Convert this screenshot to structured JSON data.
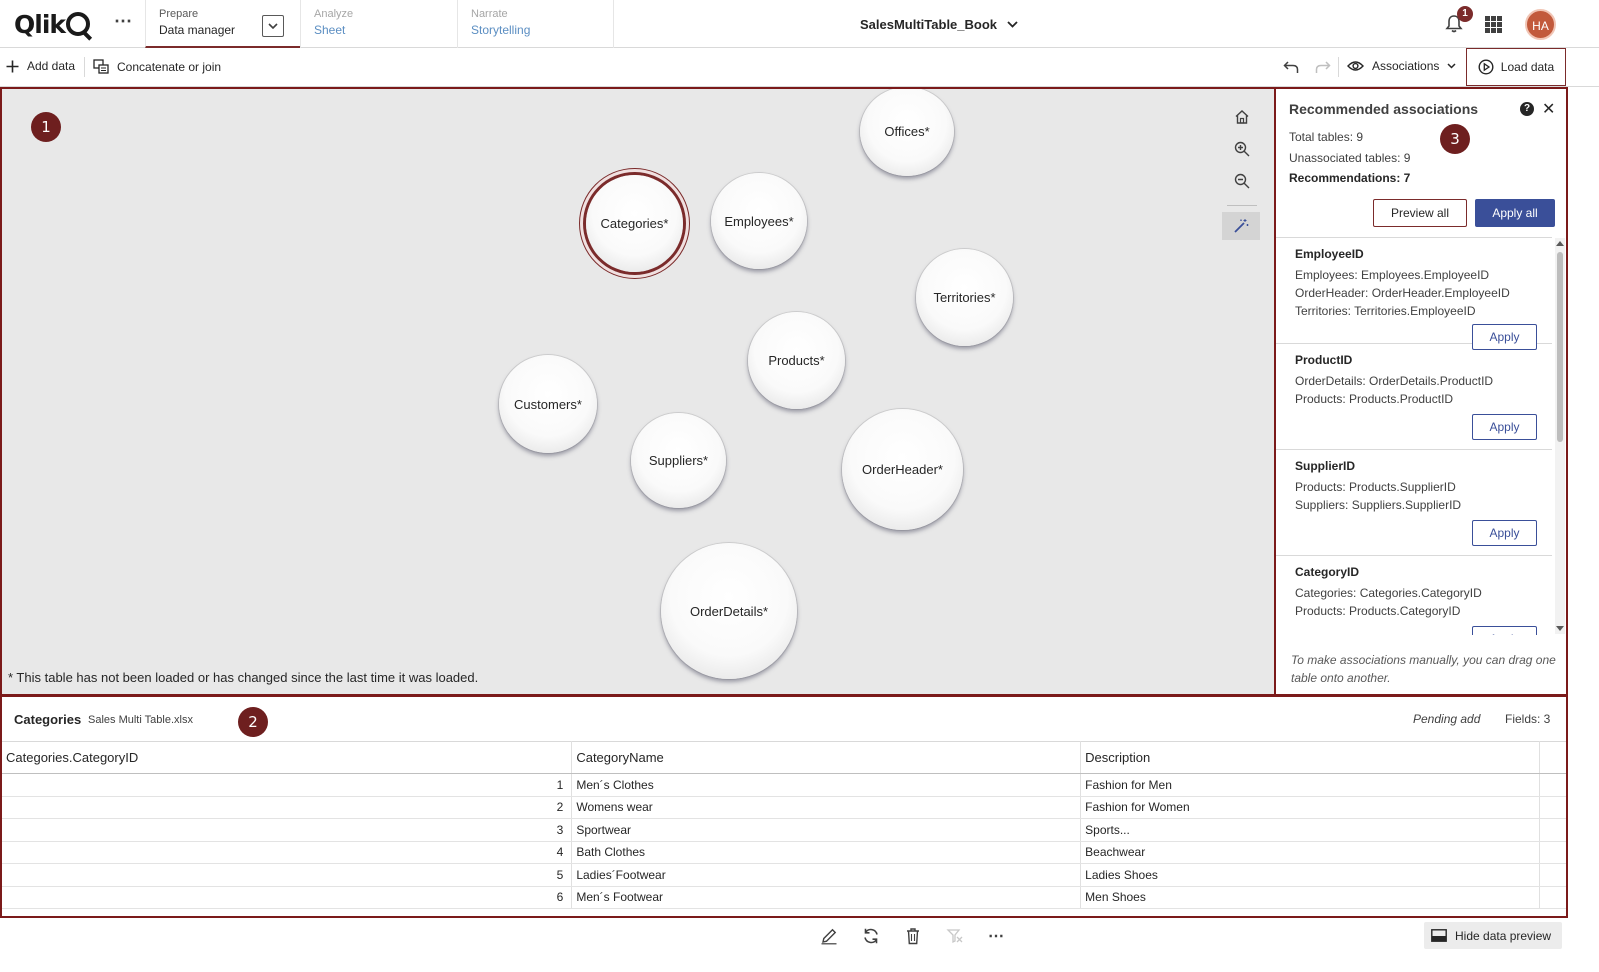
{
  "header": {
    "logo_text": "Qlik",
    "tabs": [
      {
        "small": "Prepare",
        "big": "Data manager"
      },
      {
        "small": "Analyze",
        "big": "Sheet"
      },
      {
        "small": "Narrate",
        "big": "Storytelling"
      }
    ],
    "app_title": "SalesMultiTable_Book",
    "notification_count": "1",
    "avatar_initials": "HA"
  },
  "toolbar": {
    "add_data": "Add data",
    "concat_join": "Concatenate or join",
    "associations": "Associations",
    "load_data": "Load data"
  },
  "markers": [
    "1",
    "2",
    "3"
  ],
  "canvas": {
    "tables": [
      {
        "name": "Offices*"
      },
      {
        "name": "Categories*",
        "selected": true
      },
      {
        "name": "Employees*"
      },
      {
        "name": "Territories*"
      },
      {
        "name": "Products*"
      },
      {
        "name": "Customers*"
      },
      {
        "name": "Suppliers*"
      },
      {
        "name": "OrderHeader*"
      },
      {
        "name": "OrderDetails*"
      }
    ],
    "note": "* This table has not been loaded or has changed since the last time it was loaded."
  },
  "panel": {
    "title": "Recommended associations",
    "total_tables": "Total tables: 9",
    "unassociated_tables": "Unassociated tables: 9",
    "recommendations": "Recommendations: 7",
    "preview_all": "Preview all",
    "apply_all": "Apply all",
    "cards": [
      {
        "field": "EmployeeID",
        "lines": [
          "Employees: Employees.EmployeeID",
          "OrderHeader: OrderHeader.EmployeeID",
          "Territories: Territories.EmployeeID"
        ],
        "apply": "Apply"
      },
      {
        "field": "ProductID",
        "lines": [
          "OrderDetails: OrderDetails.ProductID",
          "Products: Products.ProductID"
        ],
        "apply": "Apply"
      },
      {
        "field": "SupplierID",
        "lines": [
          "Products: Products.SupplierID",
          "Suppliers: Suppliers.SupplierID"
        ],
        "apply": "Apply"
      },
      {
        "field": "CategoryID",
        "lines": [
          "Categories: Categories.CategoryID",
          "Products: Products.CategoryID"
        ],
        "apply": "Apply"
      }
    ],
    "hint": "To make associations manually, you can drag one table onto another."
  },
  "preview": {
    "table_name": "Categories",
    "file_name": "Sales Multi Table.xlsx",
    "status": "Pending add",
    "fields": "Fields: 3",
    "columns": [
      "Categories.CategoryID",
      "CategoryName",
      "Description"
    ],
    "rows": [
      [
        "1",
        "Men´s Clothes",
        "Fashion for Men"
      ],
      [
        "2",
        "Womens wear",
        "Fashion for Women"
      ],
      [
        "3",
        "Sportwear",
        "Sports..."
      ],
      [
        "4",
        "Bath Clothes",
        "Beachwear"
      ],
      [
        "5",
        "Ladies´Footwear",
        "Ladies Shoes"
      ],
      [
        "6",
        "Men´s Footwear",
        "Men Shoes"
      ]
    ]
  },
  "bottom": {
    "hide_preview": "Hide data preview"
  }
}
